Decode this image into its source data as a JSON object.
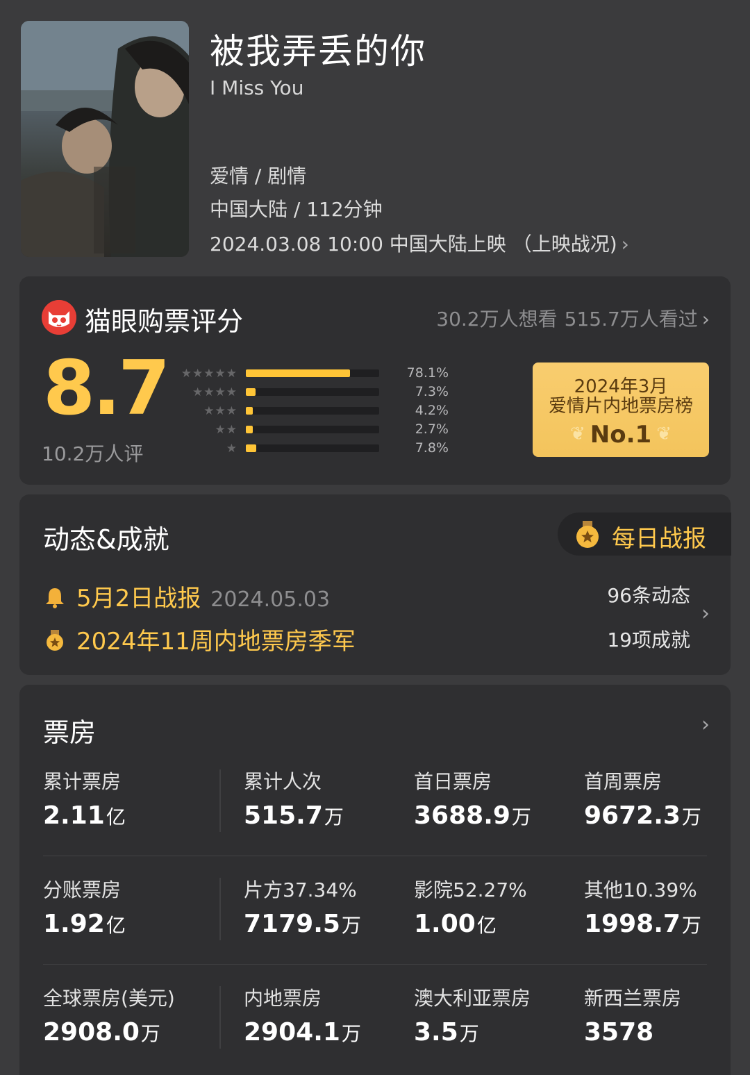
{
  "movie": {
    "title": "被我弄丢的你",
    "title_en": "I Miss You",
    "genres": "爱情 / 剧情",
    "region_runtime": "中国大陆 / 112分钟",
    "release": "2024.03.08 10:00 中国大陆上映 （上映战况)",
    "release_chevron": "›"
  },
  "rating": {
    "title": "猫眼购票评分",
    "want_to_see": "30.2万人想看",
    "watched": "515.7万人看过",
    "score": "8.7",
    "score_count": "10.2万人评",
    "distribution": [
      {
        "stars": "★★★★★",
        "percent": "78.1%",
        "value": 0.781
      },
      {
        "stars": "★★★★",
        "percent": "7.3%",
        "value": 0.073
      },
      {
        "stars": "★★★",
        "percent": "4.2%",
        "value": 0.042
      },
      {
        "stars": "★★",
        "percent": "2.7%",
        "value": 0.027
      },
      {
        "stars": "★",
        "percent": "7.8%",
        "value": 0.078
      }
    ],
    "badge": {
      "line1": "2024年3月",
      "line2": "爱情片内地票房榜",
      "rank": "No.1"
    }
  },
  "dynamics": {
    "title": "动态&成就",
    "daily_report": "每日战报",
    "items": [
      {
        "icon": "bell-icon",
        "text": "5月2日战报",
        "date": "2024.05.03"
      },
      {
        "icon": "medal-icon",
        "text": "2024年11周内地票房季军",
        "date": ""
      }
    ],
    "updates_count": "96条动态",
    "achievements_count": "19项成就"
  },
  "box_office": {
    "title": "票房",
    "rows": [
      [
        {
          "label": "累计票房",
          "value": "2.11",
          "unit": "亿"
        },
        {
          "label": "累计人次",
          "value": "515.7",
          "unit": "万"
        },
        {
          "label": "首日票房",
          "value": "3688.9",
          "unit": "万"
        },
        {
          "label": "首周票房",
          "value": "9672.3",
          "unit": "万"
        }
      ],
      [
        {
          "label": "分账票房",
          "value": "1.92",
          "unit": "亿"
        },
        {
          "label": "片方37.34%",
          "value": "7179.5",
          "unit": "万"
        },
        {
          "label": "影院52.27%",
          "value": "1.00",
          "unit": "亿"
        },
        {
          "label": "其他10.39%",
          "value": "1998.7",
          "unit": "万"
        }
      ],
      [
        {
          "label": "全球票房(美元)",
          "value": "2908.0",
          "unit": "万"
        },
        {
          "label": "内地票房",
          "value": "2904.1",
          "unit": "万"
        },
        {
          "label": "澳大利亚票房",
          "value": "3.5",
          "unit": "万"
        },
        {
          "label": "新西兰票房",
          "value": "3578",
          "unit": ""
        }
      ]
    ]
  },
  "colors": {
    "accent": "#ffc94d",
    "bar": "#ffc537",
    "badge_bg": "#f6c965",
    "card_bg": "#2f2f31",
    "page_bg": "#3b3b3d",
    "maoyan_red": "#e83e36"
  }
}
